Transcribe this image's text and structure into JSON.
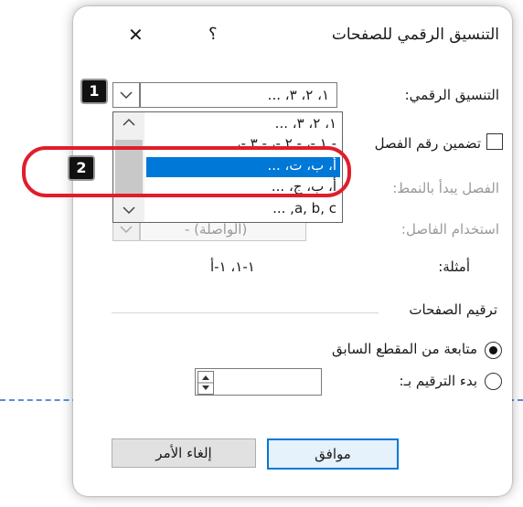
{
  "dialog": {
    "title": "التنسيق الرقمي للصفحات",
    "help_label": "؟",
    "close_label": "✕"
  },
  "format": {
    "label": "التنسيق الرقمي:",
    "value": "١، ٢، ٣، ..."
  },
  "dropdown_list": {
    "items": [
      "١، ٢، ٣، ...",
      "- ١ -، - ٢ -، - ٣ -، ...",
      "أ، ب، ت، ...",
      "أ، ب، ج، ...",
      "a, b, c, ..."
    ],
    "selected_index": 2
  },
  "include_chapter": {
    "label": "تضمين رقم الفصل",
    "checked": false
  },
  "chapter_starts": {
    "label": "الفصل يبدأ بالنمط:"
  },
  "separator": {
    "label": "استخدام الفاصل:",
    "value": "-   (الواصلة)"
  },
  "examples": {
    "label": "أمثلة:",
    "value": "١-١، ١-أ"
  },
  "page_numbering": {
    "heading": "ترقيم الصفحات",
    "continue_label": "متابعة من المقطع السابق",
    "start_at_label": "بدء الترقيم بـ:",
    "selected": "continue"
  },
  "buttons": {
    "ok": "موافق",
    "cancel": "إلغاء الأمر"
  },
  "callouts": {
    "badge1": "1",
    "badge2": "2"
  },
  "colors": {
    "callout_red": "#e11d2b",
    "selection_blue": "#0078d7",
    "dashed_line": "#5b8fd6"
  }
}
